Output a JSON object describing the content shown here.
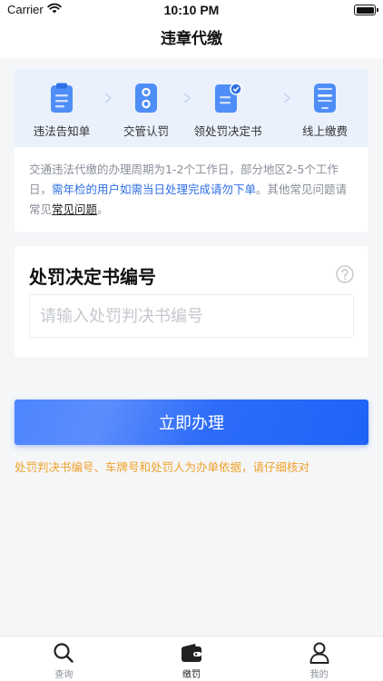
{
  "status_bar": {
    "carrier": "Carrier",
    "time": "10:10 PM"
  },
  "nav": {
    "title": "违章代缴"
  },
  "steps": [
    {
      "label": "违法告知单",
      "icon": "notice-clipboard-icon"
    },
    {
      "label": "交管认罚",
      "icon": "traffic-light-icon"
    },
    {
      "label": "领处罚决定书",
      "icon": "decision-document-icon"
    },
    {
      "label": "线上缴费",
      "icon": "mobile-payment-icon"
    }
  ],
  "notice": {
    "part1": "交通违法代缴的办理周期为1-2个工作日，部分地区2-5个工作日，",
    "highlight": "需年检的用户如需当日处理完成请勿下单",
    "part2": "。其他常见问题请常见",
    "link": "常见问题",
    "part3": "。"
  },
  "form": {
    "title": "处罚决定书编号",
    "placeholder": "请输入处罚判决书编号",
    "value": ""
  },
  "submit": {
    "label": "立即办理"
  },
  "tip": "处罚判决书编号、车牌号和处罚人为办单依据，请仔细核对",
  "tabs": [
    {
      "label": "查询",
      "icon": "search-icon",
      "active": false
    },
    {
      "label": "缴罚",
      "icon": "wallet-icon",
      "active": true
    },
    {
      "label": "我的",
      "icon": "user-icon",
      "active": false
    }
  ],
  "colors": {
    "accent": "#2f6fe6",
    "tip": "#f0a22a",
    "step_band": "#eaf1fd"
  }
}
